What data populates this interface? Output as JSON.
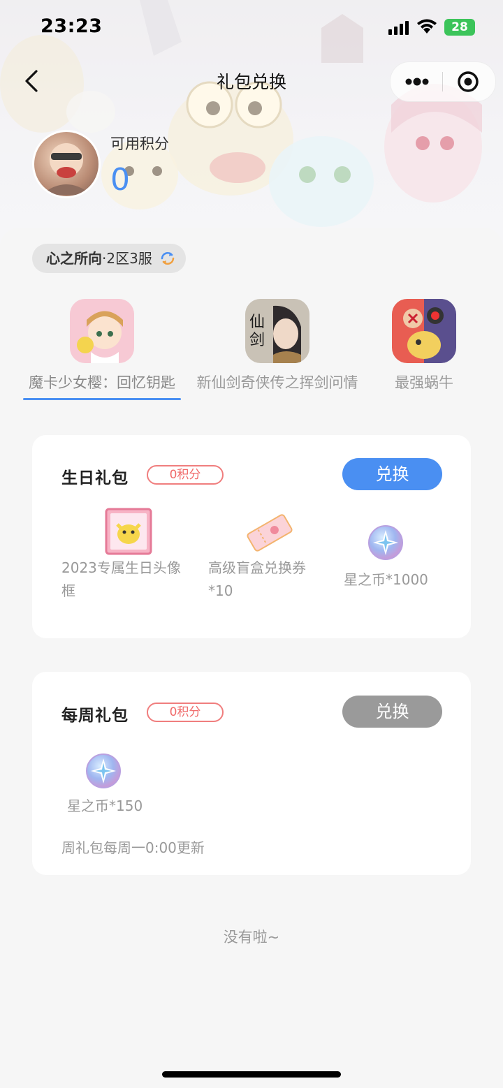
{
  "status_bar": {
    "time": "23:23",
    "battery": "28"
  },
  "nav": {
    "title": "礼包兑换"
  },
  "user": {
    "points_label": "可用积分",
    "points_value": "0"
  },
  "server": {
    "game": "心之所向",
    "zone": "·2区3服"
  },
  "games": [
    {
      "name": "魔卡少女樱：回忆钥匙",
      "active": true
    },
    {
      "name": "新仙剑奇侠传之挥剑问情",
      "active": false
    },
    {
      "name": "最强蜗牛",
      "active": false
    }
  ],
  "packages": [
    {
      "title": "生日礼包",
      "cost": "0积分",
      "button": "兑换",
      "button_state": "enabled",
      "items": [
        {
          "icon": "avatar-frame-icon",
          "label_line1": "2023专属生日头像",
          "label_line2": "框"
        },
        {
          "icon": "ticket-icon",
          "label_line1": "高级盲盒兑换券",
          "label_line2": "*10"
        },
        {
          "icon": "star-coin-icon",
          "label_line1": "星之币*1000",
          "label_line2": ""
        }
      ]
    },
    {
      "title": "每周礼包",
      "cost": "0积分",
      "button": "兑换",
      "button_state": "disabled",
      "items": [
        {
          "icon": "star-coin-icon",
          "label_line1": "星之币*150",
          "label_line2": ""
        }
      ],
      "note": "周礼包每周一0:00更新"
    }
  ],
  "footer_text": "没有啦~",
  "colors": {
    "accent": "#4a8ff2",
    "badge": "#f06a6a",
    "disabled": "#9a9a9a"
  }
}
